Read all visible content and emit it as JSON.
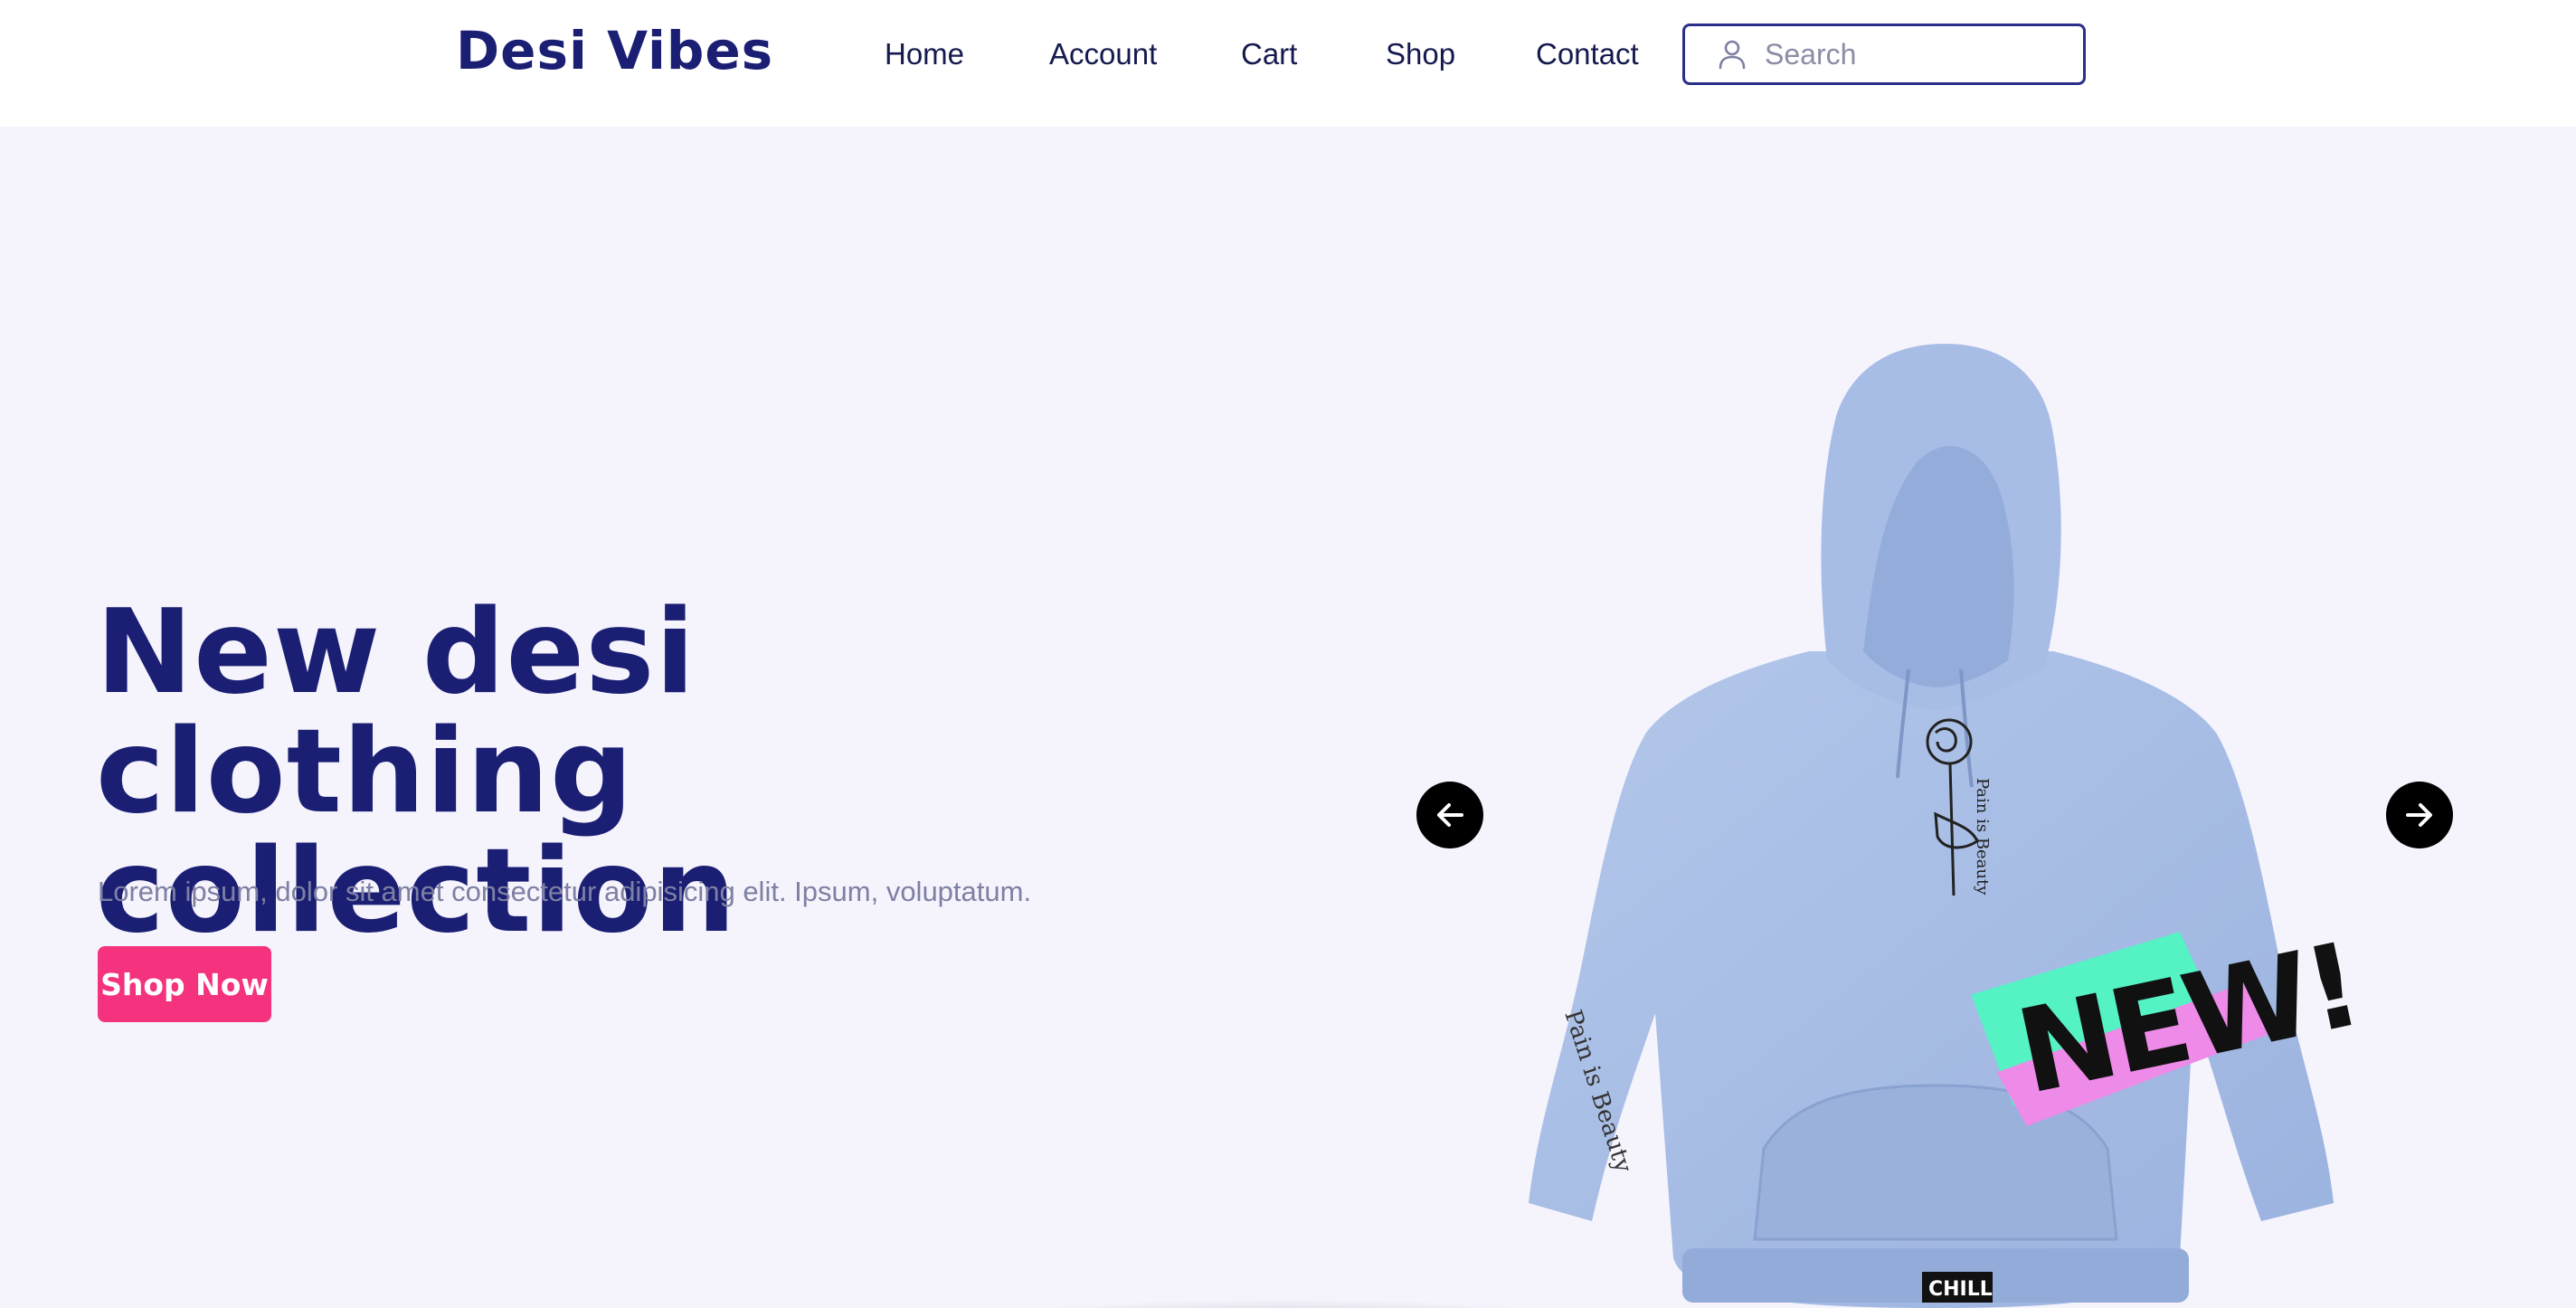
{
  "brand": {
    "name": "Desi Vibes"
  },
  "nav": {
    "items": [
      {
        "label": "Home"
      },
      {
        "label": "Account"
      },
      {
        "label": "Cart"
      },
      {
        "label": "Shop"
      },
      {
        "label": "Contact"
      }
    ]
  },
  "search": {
    "placeholder": "Search",
    "icon": "user-icon"
  },
  "hero": {
    "title": "New desi clothing collection",
    "subtitle": "Lorem ipsum, dolor sit amet consectetur adipisicing elit. Ipsum, voluptatum.",
    "cta_label": "Shop Now",
    "product": {
      "sleeve_print": "Pain is Beauty",
      "chest_print": "Pain is Beauty",
      "badge_text": "NEW!",
      "tag_text": "CHILL"
    },
    "prev_icon": "arrow-left-icon",
    "next_icon": "arrow-right-icon"
  },
  "colors": {
    "brand": "#1b1f74",
    "accent": "#f4327e",
    "hero_bg": "#f5f3fc",
    "hoodie": "#a6bde4"
  }
}
